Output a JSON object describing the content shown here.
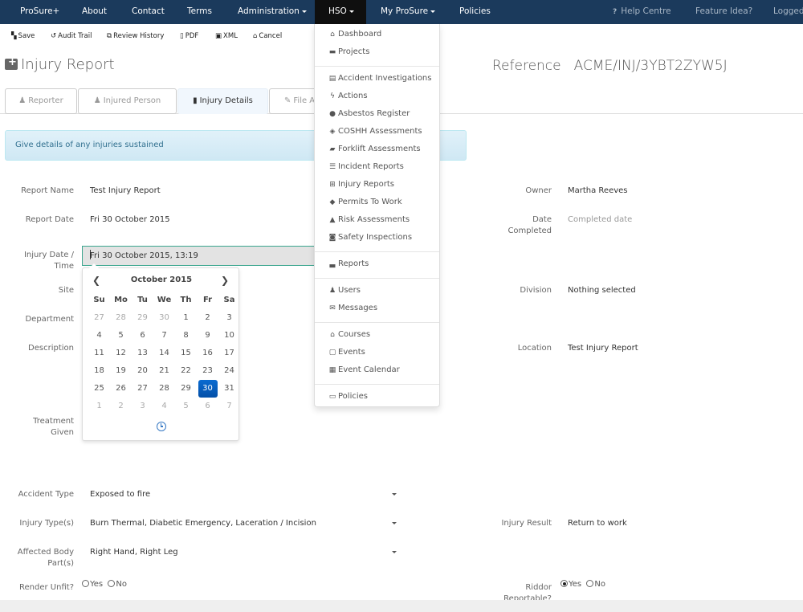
{
  "topnav": {
    "items": [
      {
        "label": "ProSure+"
      },
      {
        "label": "About"
      },
      {
        "label": "Contact"
      },
      {
        "label": "Terms"
      },
      {
        "label": "Administration",
        "dropdown": true
      },
      {
        "label": "HSO",
        "dropdown": true,
        "active": true
      },
      {
        "label": "My ProSure",
        "dropdown": true
      },
      {
        "label": "Policies"
      }
    ],
    "help_icon": "?",
    "help": "Help Centre",
    "feature": "Feature Idea?",
    "logged": "Logged"
  },
  "toolbar": {
    "save": "Save",
    "audit": "Audit Trail",
    "review": "Review History",
    "pdf": "PDF",
    "xml": "XML",
    "cancel": "Cancel"
  },
  "page": {
    "title": "Injury Report",
    "reference_label": "Reference",
    "reference_value": "ACME/INJ/3YBT2ZYW5J"
  },
  "tabs": [
    {
      "label": "Reporter",
      "icon": "user-icon"
    },
    {
      "label": "Injured Person",
      "icon": "user-icon"
    },
    {
      "label": "Injury Details",
      "icon": "file-icon",
      "active": true
    },
    {
      "label": "File A",
      "icon": "paperclip-icon"
    }
  ],
  "alert": "Give details of any injuries sustained",
  "form": {
    "report_name_label": "Report Name",
    "report_name": "Test Injury Report",
    "report_date_label": "Report Date",
    "report_date": "Fri 30 October 2015",
    "injury_date_label_1": "Injury Date /",
    "injury_date_label_2": "Time",
    "injury_date": "Fri 30 October 2015, 13:19",
    "site_label": "Site",
    "department_label": "Department",
    "description_label": "Description",
    "treatment_label_1": "Treatment",
    "treatment_label_2": "Given",
    "owner_label": "Owner",
    "owner": "Martha Reeves",
    "date_completed_label_1": "Date",
    "date_completed_label_2": "Completed",
    "date_completed_placeholder": "Completed date",
    "division_label": "Division",
    "division": "Nothing selected",
    "location_label": "Location",
    "location": "Test Injury Report",
    "accident_type_label": "Accident Type",
    "accident_type": "Exposed to fire",
    "injury_types_label": "Injury Type(s)",
    "injury_types": "Burn Thermal, Diabetic Emergency, Laceration / Incision",
    "body_parts_label_1": "Affected Body",
    "body_parts_label_2": "Part(s)",
    "body_parts": "Right Hand, Right Leg",
    "injury_result_label": "Injury Result",
    "injury_result": "Return to work",
    "render_unfit_label": "Render Unfit?",
    "render_unfit": {
      "yes": "Yes",
      "no": "No",
      "selected": null
    },
    "riddor_label_1": "Riddor",
    "riddor_label_2": "Reportable?",
    "riddor": {
      "yes": "Yes",
      "no": "No",
      "selected": "Yes"
    }
  },
  "calendar": {
    "title": "October 2015",
    "prev": "‹",
    "next": "›",
    "dow": [
      "Su",
      "Mo",
      "Tu",
      "We",
      "Th",
      "Fr",
      "Sa"
    ],
    "weeks": [
      [
        {
          "d": "27",
          "old": true
        },
        {
          "d": "28",
          "old": true
        },
        {
          "d": "29",
          "old": true
        },
        {
          "d": "30",
          "old": true
        },
        {
          "d": "1"
        },
        {
          "d": "2"
        },
        {
          "d": "3"
        }
      ],
      [
        {
          "d": "4"
        },
        {
          "d": "5"
        },
        {
          "d": "6"
        },
        {
          "d": "7"
        },
        {
          "d": "8"
        },
        {
          "d": "9"
        },
        {
          "d": "10"
        }
      ],
      [
        {
          "d": "11"
        },
        {
          "d": "12"
        },
        {
          "d": "13"
        },
        {
          "d": "14"
        },
        {
          "d": "15"
        },
        {
          "d": "16"
        },
        {
          "d": "17"
        }
      ],
      [
        {
          "d": "18"
        },
        {
          "d": "19"
        },
        {
          "d": "20"
        },
        {
          "d": "21"
        },
        {
          "d": "22"
        },
        {
          "d": "23"
        },
        {
          "d": "24"
        }
      ],
      [
        {
          "d": "25"
        },
        {
          "d": "26"
        },
        {
          "d": "27"
        },
        {
          "d": "28"
        },
        {
          "d": "29"
        },
        {
          "d": "30",
          "selected": true
        },
        {
          "d": "31"
        }
      ],
      [
        {
          "d": "1",
          "old": true
        },
        {
          "d": "2",
          "old": true
        },
        {
          "d": "3",
          "old": true
        },
        {
          "d": "4",
          "old": true
        },
        {
          "d": "5",
          "old": true
        },
        {
          "d": "6",
          "old": true
        },
        {
          "d": "7",
          "old": true
        }
      ]
    ],
    "selected_color": "#0a6bd1"
  },
  "hso_menu": [
    {
      "label": "Dashboard",
      "icon": "home-icon",
      "glyph": "⌂"
    },
    {
      "label": "Projects",
      "icon": "briefcase-icon",
      "glyph": "▬"
    },
    {
      "divider": true
    },
    {
      "label": "Accident Investigations",
      "icon": "clipboard-icon",
      "glyph": "▤"
    },
    {
      "label": "Actions",
      "icon": "flash-icon",
      "glyph": "ϟ"
    },
    {
      "label": "Asbestos Register",
      "icon": "hazard-icon",
      "glyph": "●"
    },
    {
      "label": "COSHH Assessments",
      "icon": "target-icon",
      "glyph": "◈"
    },
    {
      "label": "Forklift Assessments",
      "icon": "truck-icon",
      "glyph": "▰"
    },
    {
      "label": "Incident Reports",
      "icon": "list-icon",
      "glyph": "☰"
    },
    {
      "label": "Injury Reports",
      "icon": "medkit-icon",
      "glyph": "⊞"
    },
    {
      "label": "Permits To Work",
      "icon": "tag-icon",
      "glyph": "◆"
    },
    {
      "label": "Risk Assessments",
      "icon": "warning-icon",
      "glyph": "▲"
    },
    {
      "label": "Safety Inspections",
      "icon": "shield-icon",
      "glyph": "◙"
    },
    {
      "divider": true
    },
    {
      "label": "Reports",
      "icon": "chart-icon",
      "glyph": "▃"
    },
    {
      "divider": true
    },
    {
      "label": "Users",
      "icon": "user-icon",
      "glyph": "♟"
    },
    {
      "label": "Messages",
      "icon": "envelope-icon",
      "glyph": "✉"
    },
    {
      "divider": true
    },
    {
      "label": "Courses",
      "icon": "graduation-cap-icon",
      "glyph": "⌂"
    },
    {
      "label": "Events",
      "icon": "calendar-icon",
      "glyph": "▢"
    },
    {
      "label": "Event Calendar",
      "icon": "calendar-grid-icon",
      "glyph": "▦"
    },
    {
      "divider": true
    },
    {
      "label": "Policies",
      "icon": "card-icon",
      "glyph": "▭"
    }
  ]
}
